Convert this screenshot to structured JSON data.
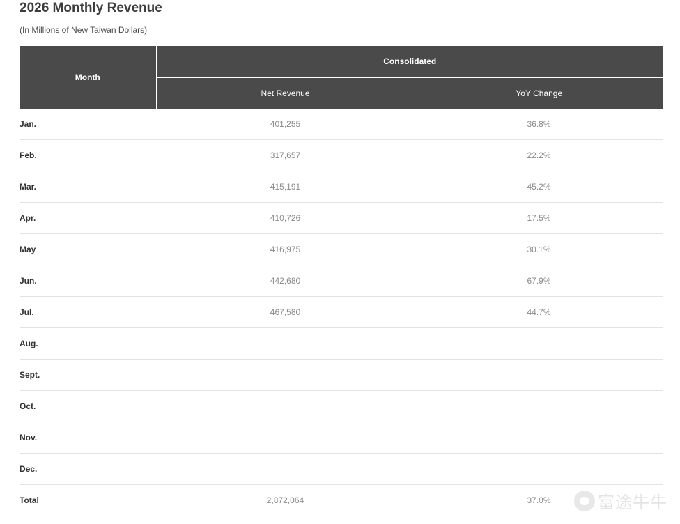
{
  "header": {
    "title": "2026 Monthly Revenue",
    "subtitle": "(In Millions of New Taiwan Dollars)"
  },
  "table": {
    "month_header": "Month",
    "group_header": "Consolidated",
    "net_revenue_header": "Net Revenue",
    "yoy_header": "YoY Change",
    "rows": [
      {
        "month": "Jan.",
        "net_revenue": "401,255",
        "yoy": "36.8%"
      },
      {
        "month": "Feb.",
        "net_revenue": "317,657",
        "yoy": "22.2%"
      },
      {
        "month": "Mar.",
        "net_revenue": "415,191",
        "yoy": "45.2%"
      },
      {
        "month": "Apr.",
        "net_revenue": "410,726",
        "yoy": "17.5%"
      },
      {
        "month": "May",
        "net_revenue": "416,975",
        "yoy": "30.1%"
      },
      {
        "month": "Jun.",
        "net_revenue": "442,680",
        "yoy": "67.9%"
      },
      {
        "month": "Jul.",
        "net_revenue": "467,580",
        "yoy": "44.7%"
      },
      {
        "month": "Aug.",
        "net_revenue": "",
        "yoy": ""
      },
      {
        "month": "Sept.",
        "net_revenue": "",
        "yoy": ""
      },
      {
        "month": "Oct.",
        "net_revenue": "",
        "yoy": ""
      },
      {
        "month": "Nov.",
        "net_revenue": "",
        "yoy": ""
      },
      {
        "month": "Dec.",
        "net_revenue": "",
        "yoy": ""
      }
    ],
    "total": {
      "month": "Total",
      "net_revenue": "2,872,064",
      "yoy": "37.0%"
    }
  },
  "watermark": {
    "text": "富途牛牛",
    "icon": "futu-logo-icon"
  },
  "colors": {
    "header_bg": "#4a4a4a",
    "header_text": "#ffffff",
    "row_divider": "#e3e3e3",
    "value_text": "#8a8a8a"
  }
}
